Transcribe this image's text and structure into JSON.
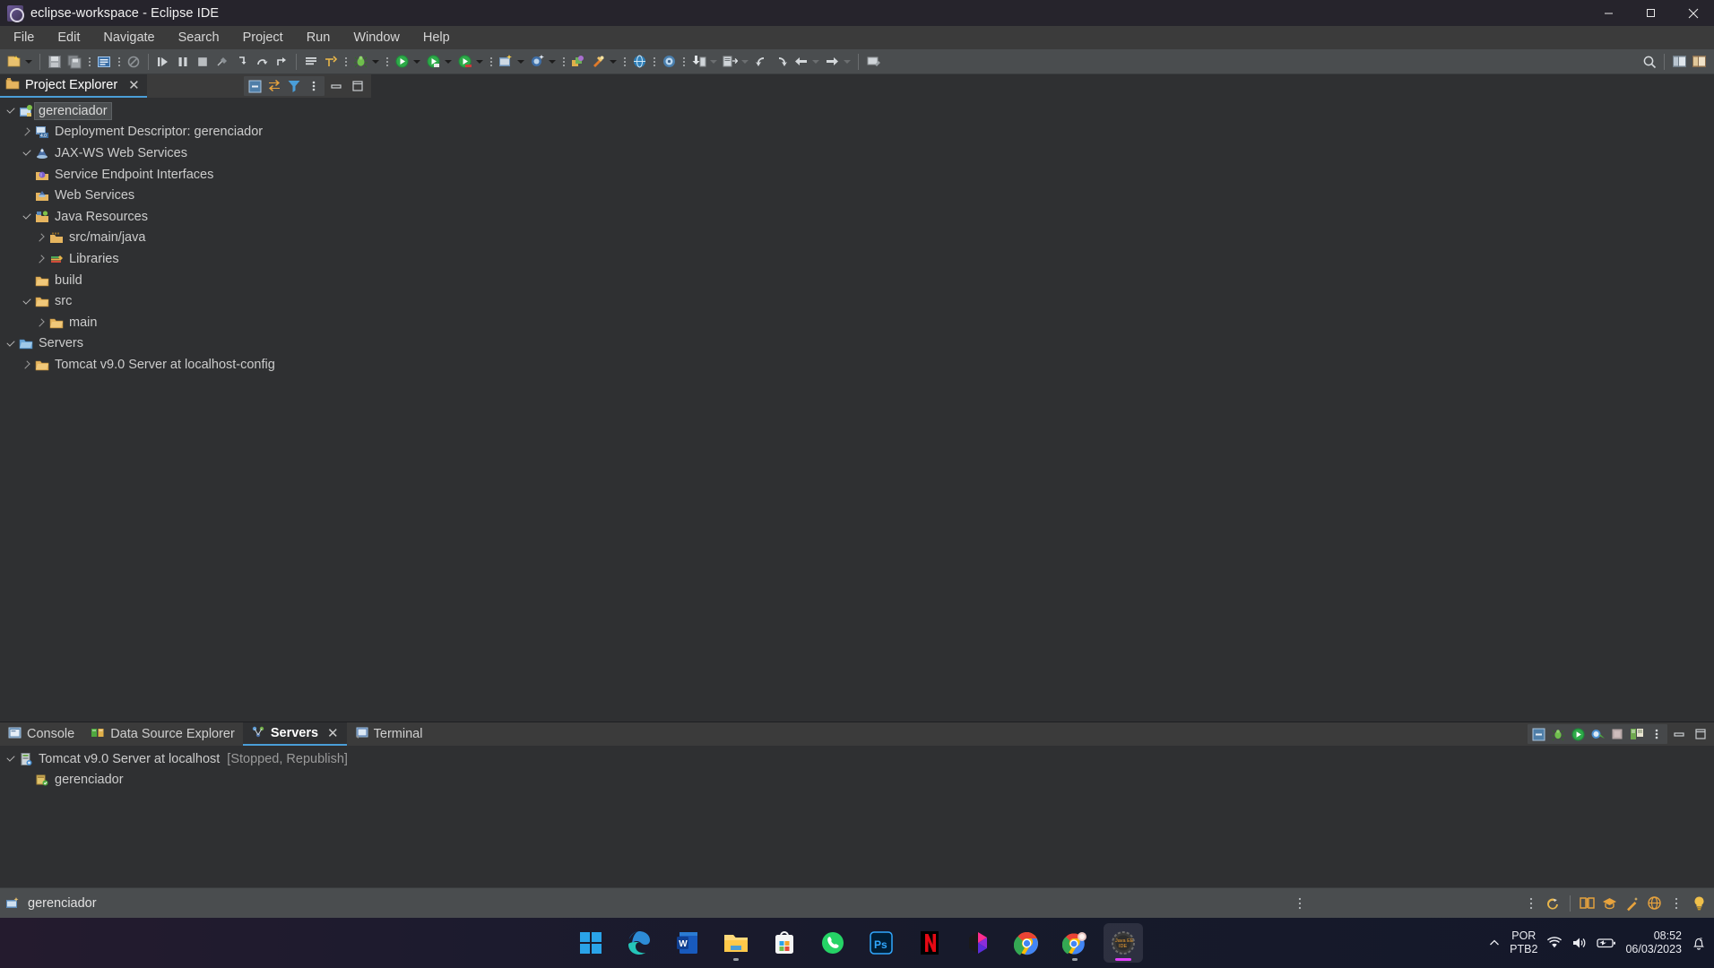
{
  "window": {
    "title": "eclipse-workspace - Eclipse IDE",
    "app_icon": "eclipse-icon",
    "controls": {
      "minimize": "minimize-button",
      "maximize": "maximize-button",
      "close": "close-button"
    }
  },
  "menubar": {
    "items": [
      {
        "label": "File"
      },
      {
        "label": "Edit"
      },
      {
        "label": "Navigate"
      },
      {
        "label": "Search"
      },
      {
        "label": "Project"
      },
      {
        "label": "Run"
      },
      {
        "label": "Window"
      },
      {
        "label": "Help"
      }
    ]
  },
  "toolbar": {
    "items": [
      {
        "name": "new-wizard-icon"
      },
      {
        "name": "new-wizard-dropdown"
      },
      {
        "name": "save-icon"
      },
      {
        "name": "save-all-icon"
      },
      {
        "name": "open-type-icon"
      },
      {
        "name": "print-icon"
      },
      {
        "name": "resume-icon"
      },
      {
        "name": "suspend-icon"
      },
      {
        "name": "terminate-icon"
      },
      {
        "name": "disconnect-icon"
      },
      {
        "name": "step-into-icon"
      },
      {
        "name": "step-over-icon"
      },
      {
        "name": "step-return-icon"
      },
      {
        "name": "toggle-breakpoints-icon"
      },
      {
        "name": "skip-breakpoints-icon"
      },
      {
        "name": "debug-icon"
      },
      {
        "name": "debug-dropdown"
      },
      {
        "name": "run-icon"
      },
      {
        "name": "run-dropdown"
      },
      {
        "name": "run-as-icon"
      },
      {
        "name": "run-as-dropdown"
      },
      {
        "name": "coverage-icon"
      },
      {
        "name": "coverage-dropdown"
      },
      {
        "name": "new-java-project-icon"
      },
      {
        "name": "new-java-project-dropdown"
      },
      {
        "name": "new-class-icon"
      },
      {
        "name": "new-class-dropdown"
      },
      {
        "name": "open-perspective-icon"
      },
      {
        "name": "search-icon-toolbar"
      },
      {
        "name": "search-dropdown"
      },
      {
        "name": "open-web-browser-icon"
      },
      {
        "name": "open-task-icon"
      },
      {
        "name": "import-icon"
      },
      {
        "name": "import-dropdown"
      },
      {
        "name": "export-icon"
      },
      {
        "name": "export-dropdown"
      },
      {
        "name": "previous-annotation-icon"
      },
      {
        "name": "next-annotation-icon"
      },
      {
        "name": "back-icon"
      },
      {
        "name": "back-dropdown"
      },
      {
        "name": "forward-icon"
      },
      {
        "name": "forward-dropdown"
      },
      {
        "name": "pin-editor-icon"
      }
    ],
    "right_items": [
      {
        "name": "quick-access-search-icon"
      },
      {
        "name": "open-java-perspective-icon"
      },
      {
        "name": "open-javaee-perspective-icon"
      }
    ]
  },
  "explorer": {
    "tab": {
      "label": "Project Explorer",
      "icon": "project-explorer-icon",
      "close": "✕"
    },
    "toolbar": [
      {
        "name": "collapse-all-icon"
      },
      {
        "name": "link-with-editor-icon"
      },
      {
        "name": "filter-icon"
      },
      {
        "name": "view-menu-icon"
      },
      {
        "name": "minimize-view-icon"
      },
      {
        "name": "maximize-view-icon"
      }
    ],
    "tree": [
      {
        "label": "gerenciador",
        "icon": "dynamic-web-project-icon",
        "indent": 0,
        "twist": "expanded",
        "selected": true
      },
      {
        "label": "Deployment Descriptor: gerenciador",
        "icon": "deployment-descriptor-icon",
        "indent": 1,
        "twist": "collapsed",
        "selected": false
      },
      {
        "label": "JAX-WS Web Services",
        "icon": "jaxws-icon",
        "indent": 1,
        "twist": "expanded",
        "selected": false
      },
      {
        "label": "Service Endpoint Interfaces",
        "icon": "service-endpoint-icon",
        "indent": 2,
        "twist": "none",
        "selected": false
      },
      {
        "label": "Web Services",
        "icon": "web-services-icon",
        "indent": 2,
        "twist": "none",
        "selected": false
      },
      {
        "label": "Java Resources",
        "icon": "java-resources-icon",
        "indent": 1,
        "twist": "expanded",
        "selected": false
      },
      {
        "label": "src/main/java",
        "icon": "source-folder-icon",
        "indent": 2,
        "twist": "collapsed",
        "selected": false
      },
      {
        "label": "Libraries",
        "icon": "libraries-icon",
        "indent": 2,
        "twist": "collapsed",
        "selected": false
      },
      {
        "label": "build",
        "icon": "folder-icon",
        "indent": 2,
        "twist": "none",
        "selected": false
      },
      {
        "label": "src",
        "icon": "folder-icon",
        "indent": 1,
        "twist": "expanded",
        "selected": false
      },
      {
        "label": "main",
        "icon": "folder-icon",
        "indent": 2,
        "twist": "collapsed",
        "selected": false
      },
      {
        "label": "Servers",
        "icon": "servers-folder-icon",
        "indent": 0,
        "twist": "expanded",
        "selected": false
      },
      {
        "label": "Tomcat v9.0 Server at localhost-config",
        "icon": "folder-icon",
        "indent": 1,
        "twist": "collapsed",
        "selected": false
      }
    ]
  },
  "bottom_panel": {
    "tabs": [
      {
        "label": "Console",
        "icon": "console-icon",
        "active": false
      },
      {
        "label": "Data Source Explorer",
        "icon": "data-source-explorer-icon",
        "active": false
      },
      {
        "label": "Servers",
        "icon": "servers-icon",
        "active": true,
        "close": "✕"
      },
      {
        "label": "Terminal",
        "icon": "terminal-icon",
        "active": false
      }
    ],
    "toolbar": [
      {
        "name": "collapse-all-icon"
      },
      {
        "name": "debug-server-icon"
      },
      {
        "name": "start-server-icon"
      },
      {
        "name": "profile-server-icon"
      },
      {
        "name": "stop-server-icon"
      },
      {
        "name": "publish-server-icon"
      },
      {
        "name": "view-menu-icon"
      },
      {
        "name": "minimize-view-icon"
      },
      {
        "name": "maximize-view-icon"
      }
    ],
    "servers": [
      {
        "label": "Tomcat v9.0 Server at localhost",
        "status": "[Stopped, Republish]",
        "icon": "tomcat-server-icon",
        "twist": "expanded",
        "indent": 0
      },
      {
        "label": "gerenciador",
        "status": "",
        "icon": "module-icon",
        "twist": "none",
        "indent": 1
      }
    ]
  },
  "statusbar": {
    "icon": "project-icon",
    "label": "gerenciador",
    "right_icons": [
      {
        "name": "view-menu-icon"
      },
      {
        "name": "undo-history-icon"
      },
      {
        "name": "open-book-icon"
      },
      {
        "name": "tutorials-icon"
      },
      {
        "name": "wand-icon"
      },
      {
        "name": "web-resources-icon"
      },
      {
        "name": "tips-and-tricks-icon"
      }
    ]
  },
  "taskbar": {
    "apps": [
      {
        "name": "start-button-icon",
        "running": false
      },
      {
        "name": "microsoft-edge-icon",
        "running": false
      },
      {
        "name": "microsoft-word-icon",
        "running": false
      },
      {
        "name": "file-explorer-icon",
        "running": true
      },
      {
        "name": "microsoft-store-icon",
        "running": false
      },
      {
        "name": "whatsapp-icon",
        "running": false
      },
      {
        "name": "photoshop-icon",
        "running": false
      },
      {
        "name": "netflix-icon",
        "running": false
      },
      {
        "name": "figma-icon",
        "running": false
      },
      {
        "name": "google-chrome-icon",
        "running": false
      },
      {
        "name": "chrome-secondary-icon",
        "running": true
      },
      {
        "name": "eclipse-ide-icon",
        "running": true,
        "active": true
      }
    ],
    "tray": {
      "show_hidden_icons": "chevron-up-icon",
      "language_line1": "POR",
      "language_line2": "PTB2",
      "wifi": "wifi-icon",
      "volume": "volume-icon",
      "battery": "battery-icon",
      "time": "08:52",
      "date": "06/03/2023",
      "notifications": "do-not-disturb-icon"
    }
  },
  "colors": {
    "accent_blue": "#4a9ed8",
    "toolbar_bg": "#4a4d4f",
    "panel_bg": "#2f3032",
    "tab_bg": "#3b3b3b",
    "titlebar_bg": "#26242c"
  }
}
